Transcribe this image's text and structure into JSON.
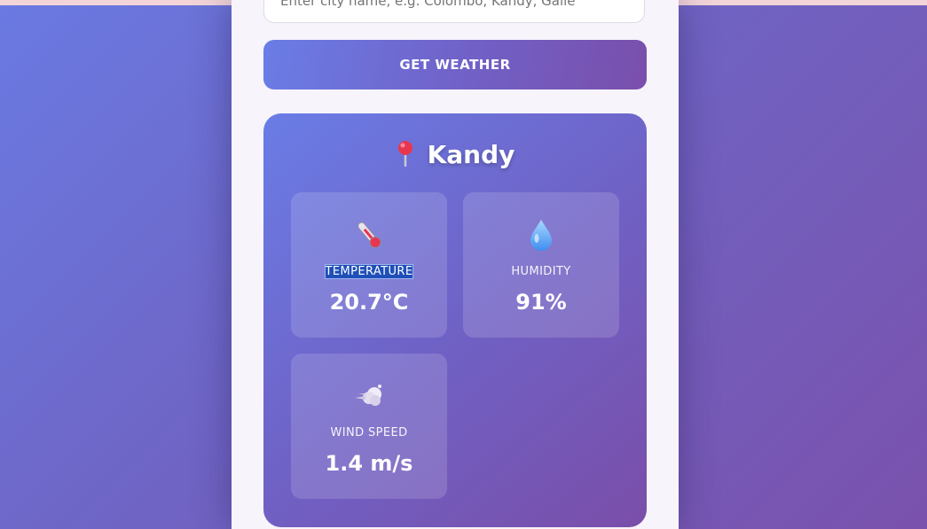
{
  "search": {
    "placeholder": "Enter city name, e.g. Colombo, Kandy, Galle"
  },
  "get_button_label": "GET WEATHER",
  "result": {
    "city": "Kandy",
    "temperature": {
      "label": "TEMPERATURE",
      "value": "20.7°C",
      "icon": "thermometer-icon"
    },
    "humidity": {
      "label": "HUMIDITY",
      "value": "91%",
      "icon": "droplet-icon"
    },
    "wind": {
      "label": "WIND SPEED",
      "value": "1.4 m/s",
      "icon": "wind-icon"
    }
  },
  "colors": {
    "accent_start": "#6a7de6",
    "accent_end": "#7a4fab",
    "pin": "#e8364f",
    "droplet": "#59a8f5"
  }
}
